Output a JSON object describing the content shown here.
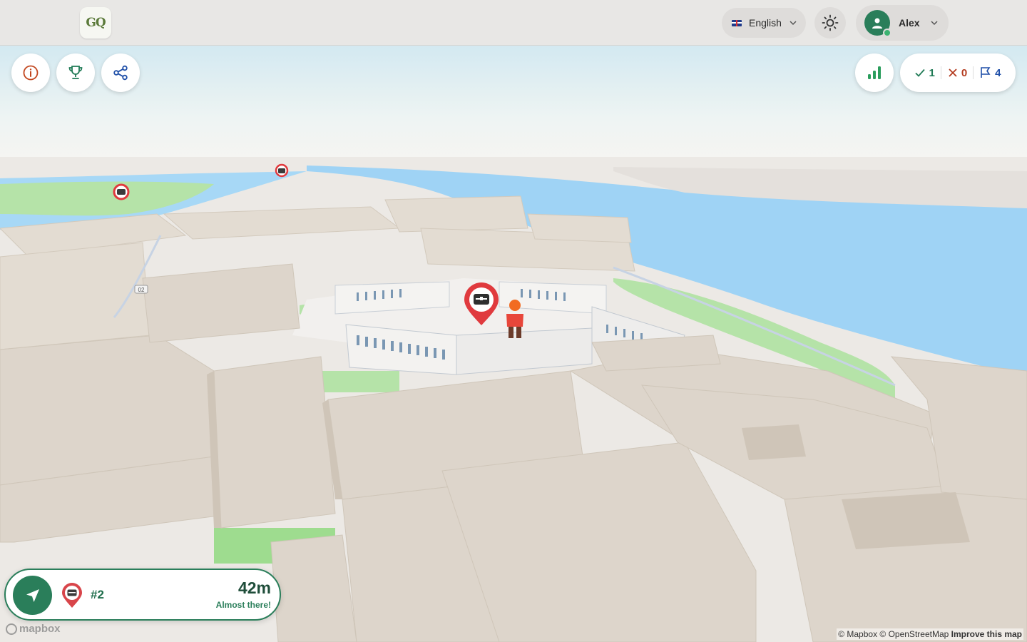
{
  "header": {
    "logo_text": "GQ",
    "language": {
      "label": "English",
      "flag": "uk-flag"
    },
    "theme_icon": "sun-icon",
    "user": {
      "name": "Alex",
      "status": "online"
    }
  },
  "toolbar_left": {
    "buttons": [
      {
        "icon": "info-icon"
      },
      {
        "icon": "trophy-icon"
      },
      {
        "icon": "share-icon"
      }
    ]
  },
  "toolbar_right": {
    "stats_icon": "bar-chart-icon",
    "score": {
      "correct": "1",
      "wrong": "0",
      "flags": "4"
    }
  },
  "target_card": {
    "index": "#2",
    "distance": "42m",
    "hint": "Almost there!",
    "nav_icon": "navigation-arrow-icon",
    "pin_icon": "treasure-chest-pin-icon"
  },
  "map": {
    "logo": "mapbox",
    "attribution": "© Mapbox © OpenStreetMap",
    "improve_link": "Improve this map",
    "road_label": "02",
    "colors": {
      "water": "#9fd3f5",
      "park": "#b5e3a8",
      "building": "#ddd5cb",
      "marker": "#e03a3e",
      "accent": "#2a7e5a"
    }
  }
}
